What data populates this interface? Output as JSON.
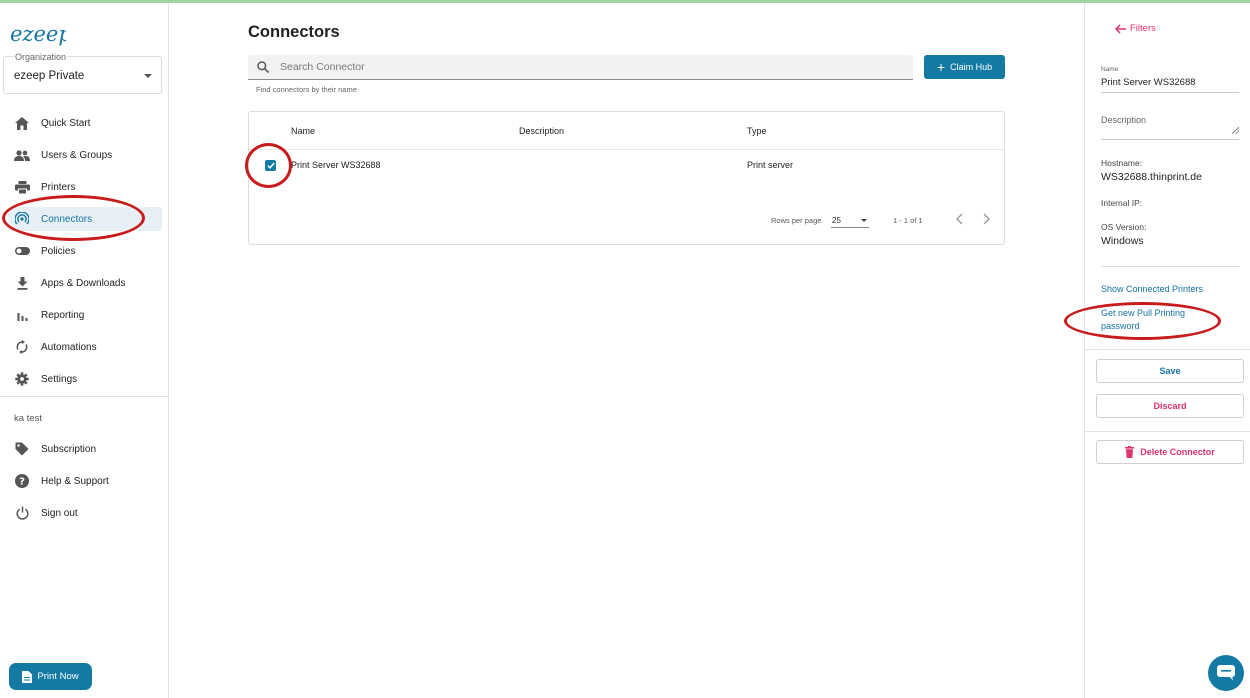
{
  "sidebar": {
    "logo": "ezeep",
    "organization_label": "Organization",
    "organization_value": "ezeep Private",
    "nav": [
      {
        "label": "Quick Start",
        "icon": "home-icon"
      },
      {
        "label": "Users & Groups",
        "icon": "users-icon"
      },
      {
        "label": "Printers",
        "icon": "printer-icon"
      },
      {
        "label": "Connectors",
        "icon": "connector-icon",
        "active": true
      },
      {
        "label": "Policies",
        "icon": "toggle-icon"
      },
      {
        "label": "Apps & Downloads",
        "icon": "download-icon"
      },
      {
        "label": "Reporting",
        "icon": "bar-chart-icon"
      },
      {
        "label": "Automations",
        "icon": "sync-icon"
      },
      {
        "label": "Settings",
        "icon": "gear-icon"
      }
    ],
    "section_label": "ka test",
    "nav2": [
      {
        "label": "Subscription",
        "icon": "tag-icon"
      },
      {
        "label": "Help & Support",
        "icon": "help-icon"
      },
      {
        "label": "Sign out",
        "icon": "power-icon"
      }
    ],
    "print_now": "Print Now"
  },
  "main": {
    "title": "Connectors",
    "search_placeholder": "Search Connector",
    "search_help": "Find connectors by their name",
    "claim_button": "Claim Hub",
    "columns": [
      "Name",
      "Description",
      "Type"
    ],
    "rows": [
      {
        "name": "Print Server WS32688",
        "description": "",
        "type": "Print server",
        "checked": true
      }
    ],
    "pager": {
      "rows_per_page_label": "Rows per page",
      "rows_per_page": "25",
      "count": "1 - 1 of 1"
    }
  },
  "panel": {
    "filters_label": "Filters",
    "name_label": "Name",
    "name_value": "Print Server WS32688",
    "description_label": "Description",
    "hostname_label": "Hostname:",
    "hostname_value": "WS32688.thinprint.de",
    "internal_ip_label": "Internal IP:",
    "os_label": "OS Version:",
    "os_value": "Windows",
    "show_printers_link": "Show Connected Printers",
    "pull_password_link": "Get new Pull Printing password",
    "save_button": "Save",
    "discard_button": "Discard",
    "delete_button": "Delete Connector"
  },
  "colors": {
    "accent": "#137aa3",
    "danger": "#e0336b",
    "annotation": "#c81b1b"
  }
}
